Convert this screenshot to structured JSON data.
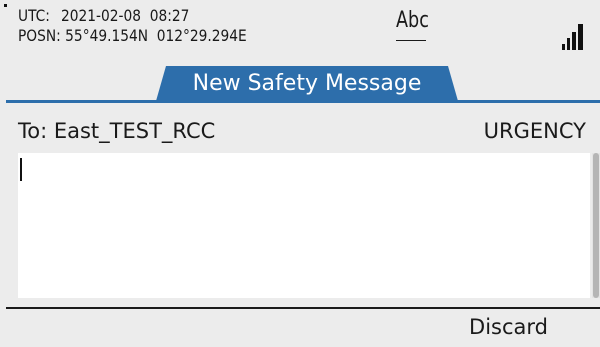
{
  "status_bar": {
    "utc_label": "UTC:",
    "utc_value": "2021-02-08  08:27",
    "position_label": "POSN:",
    "position_value": "55°49.154N  012°29.294E",
    "input_mode": "Abc",
    "signal_icon": "signal-strength-icon"
  },
  "title_tab": {
    "label": "New Safety Message",
    "color": "#2d6eab"
  },
  "message": {
    "to_label": "To: East_TEST_RCC",
    "priority": "URGENCY",
    "body": ""
  },
  "softkeys": {
    "right": "Discard"
  },
  "colors": {
    "accent": "#2d6eab",
    "background": "#ececec",
    "text_area": "#ffffff"
  }
}
